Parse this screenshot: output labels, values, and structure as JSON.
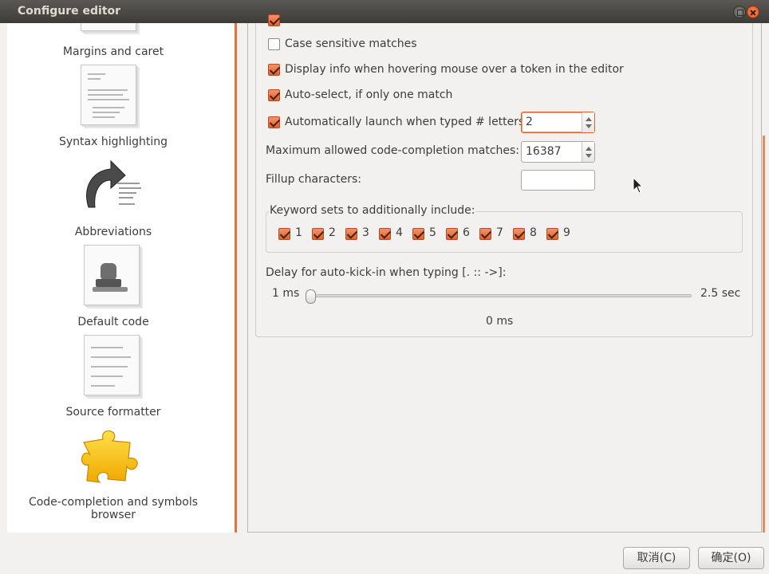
{
  "window": {
    "title": "Configure editor"
  },
  "sidebar": {
    "items": [
      {
        "label": "Margins and caret",
        "icon": "margins-caret-icon"
      },
      {
        "label": "Syntax highlighting",
        "icon": "syntax-highlighting-icon"
      },
      {
        "label": "Abbreviations",
        "icon": "abbreviations-icon"
      },
      {
        "label": "Default code",
        "icon": "default-code-icon"
      },
      {
        "label": "Source formatter",
        "icon": "source-formatter-icon"
      },
      {
        "label": "Code-completion and symbols browser",
        "icon": "puzzle-piece-icon",
        "selected": true
      }
    ]
  },
  "options": {
    "case_sensitive": {
      "label": "Case sensitive matches",
      "checked": false
    },
    "hover_info": {
      "label": "Display info when hovering mouse over a token in the editor",
      "checked": true
    },
    "auto_select": {
      "label": "Auto-select, if only one match",
      "checked": true
    },
    "auto_launch": {
      "label": "Automatically launch when typed # letters:",
      "checked": true,
      "value": "2"
    },
    "max_matches": {
      "label": "Maximum allowed code-completion matches:",
      "value": "16387"
    },
    "fillup": {
      "label": "Fillup characters:",
      "value": ""
    }
  },
  "keyword_sets": {
    "label": "Keyword sets to additionally include:",
    "items": [
      {
        "label": "1",
        "checked": true
      },
      {
        "label": "2",
        "checked": true
      },
      {
        "label": "3",
        "checked": true
      },
      {
        "label": "4",
        "checked": true
      },
      {
        "label": "5",
        "checked": true
      },
      {
        "label": "6",
        "checked": true
      },
      {
        "label": "7",
        "checked": true
      },
      {
        "label": "8",
        "checked": true
      },
      {
        "label": "9",
        "checked": true
      }
    ]
  },
  "delay": {
    "label": "Delay for auto-kick-in when typing [. :: ->]:",
    "min_label": "1 ms",
    "max_label": "2.5 sec",
    "current_label": "0 ms"
  },
  "buttons": {
    "cancel": "取消(C)",
    "ok": "确定(O)"
  },
  "colors": {
    "accent": "#e0622f",
    "titlebar": "#3c3b37",
    "background": "#f2f1f0"
  }
}
